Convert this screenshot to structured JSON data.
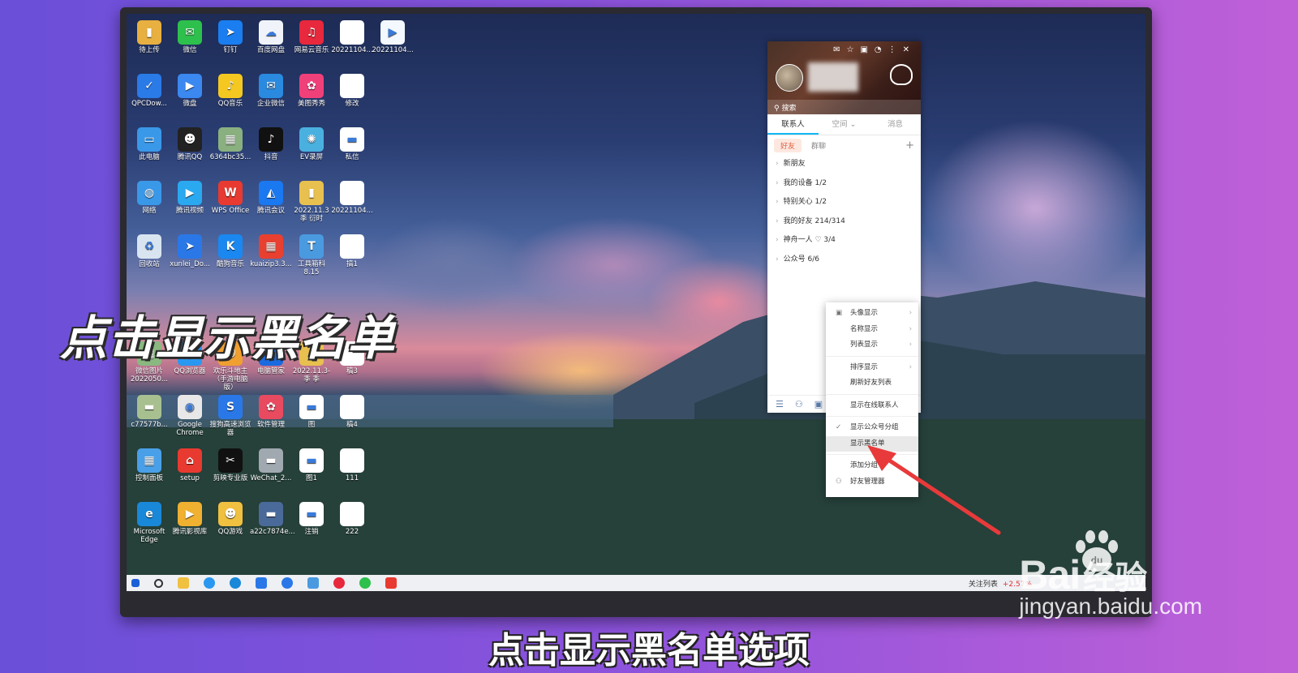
{
  "overlay": {
    "big_title": "点击显示黑名单",
    "caption": "点击显示黑名单选项"
  },
  "watermark": {
    "brand": "Bai",
    "brand_suffix": "经验",
    "url": "jingyan.baidu.com",
    "paw_label": "du"
  },
  "desktop_icons": [
    {
      "label": "待上传",
      "color": "#e8b040",
      "glyph": "▮"
    },
    {
      "label": "微信",
      "color": "#2ec04c",
      "glyph": "✉"
    },
    {
      "label": "钉钉",
      "color": "#1a7ef0",
      "glyph": "➤"
    },
    {
      "label": "百度网盘",
      "color": "#f0f4fa",
      "glyph": "☁"
    },
    {
      "label": "网易云音乐",
      "color": "#e8283c",
      "glyph": "♫"
    },
    {
      "label": "20221104...",
      "color": "#ffffff",
      "glyph": ""
    },
    {
      "label": "20221104...",
      "color": "#f4f8ff",
      "glyph": "▶"
    },
    {
      "label": "QPCDow...",
      "color": "#2a7ae8",
      "glyph": "✓"
    },
    {
      "label": "微盘",
      "color": "#3a88f0",
      "glyph": "▶"
    },
    {
      "label": "QQ音乐",
      "color": "#f4c820",
      "glyph": "♪"
    },
    {
      "label": "企业微信",
      "color": "#2a8ae0",
      "glyph": "✉"
    },
    {
      "label": "美图秀秀",
      "color": "#f0407a",
      "glyph": "✿"
    },
    {
      "label": "修改",
      "color": "#ffffff",
      "glyph": ""
    },
    {
      "label": "此电脑",
      "color": "#3a98e8",
      "glyph": "▭"
    },
    {
      "label": "腾讯QQ",
      "color": "#222222",
      "glyph": "☻"
    },
    {
      "label": "6364bc35...",
      "color": "#8ab080",
      "glyph": "▦"
    },
    {
      "label": "抖音",
      "color": "#111111",
      "glyph": "♪"
    },
    {
      "label": "EV录屏",
      "color": "#4ab0e0",
      "glyph": "✺"
    },
    {
      "label": "私信",
      "color": "#ffffff",
      "glyph": "▬"
    },
    {
      "label": "网络",
      "color": "#3a98e8",
      "glyph": "◍"
    },
    {
      "label": "腾讯视频",
      "color": "#2aa8f0",
      "glyph": "▶"
    },
    {
      "label": "WPS Office",
      "color": "#e83a30",
      "glyph": "W"
    },
    {
      "label": "腾讯会议",
      "color": "#1a78f0",
      "glyph": "◭"
    },
    {
      "label": "2022.11.3 季 衍时",
      "color": "#e8c050",
      "glyph": "▮"
    },
    {
      "label": "20221104...",
      "color": "#ffffff",
      "glyph": ""
    },
    {
      "label": "回收站",
      "color": "#d8e4f0",
      "glyph": "♻"
    },
    {
      "label": "xunlei_Do...",
      "color": "#2a78e8",
      "glyph": "➤"
    },
    {
      "label": "酷狗音乐",
      "color": "#1a88f0",
      "glyph": "K"
    },
    {
      "label": "kuaizip3.3...",
      "color": "#e84030",
      "glyph": "▦"
    },
    {
      "label": "工具箱科8.15",
      "color": "#4a9ae0",
      "glyph": "T"
    },
    {
      "label": "搞1",
      "color": "#ffffff",
      "glyph": ""
    },
    {
      "label": "微信图片 2022050...",
      "color": "#8ab880",
      "glyph": "▦"
    },
    {
      "label": "QQ浏览器",
      "color": "#2a98f0",
      "glyph": "◔"
    },
    {
      "label": "欢乐斗地主（手游电脑版）",
      "color": "#f0a030",
      "glyph": "☺"
    },
    {
      "label": "电脑管家",
      "color": "#1a6ae0",
      "glyph": "✓"
    },
    {
      "label": "2022.11.3-季 季",
      "color": "#e8c050",
      "glyph": "▮"
    },
    {
      "label": "稿3",
      "color": "#ffffff",
      "glyph": ""
    },
    {
      "label": "c77577b...",
      "color": "#a8c090",
      "glyph": "▬"
    },
    {
      "label": "Google Chrome",
      "color": "#e8e8e8",
      "glyph": "◉"
    },
    {
      "label": "搜狗高速浏览器",
      "color": "#2a78e8",
      "glyph": "S"
    },
    {
      "label": "软件管理",
      "color": "#e84a60",
      "glyph": "✿"
    },
    {
      "label": "图",
      "color": "#ffffff",
      "glyph": "▬"
    },
    {
      "label": "稿4",
      "color": "#ffffff",
      "glyph": ""
    },
    {
      "label": "控制面板",
      "color": "#4aa0e8",
      "glyph": "▦"
    },
    {
      "label": "setup",
      "color": "#e83a30",
      "glyph": "⌂"
    },
    {
      "label": "剪映专业版",
      "color": "#111111",
      "glyph": "✂"
    },
    {
      "label": "WeChat_2...",
      "color": "#a0a8b0",
      "glyph": "▬"
    },
    {
      "label": "图1",
      "color": "#ffffff",
      "glyph": "▬"
    },
    {
      "label": "111",
      "color": "#ffffff",
      "glyph": ""
    },
    {
      "label": "Microsoft Edge",
      "color": "#1a88d8",
      "glyph": "e"
    },
    {
      "label": "腾讯影视库",
      "color": "#f0b030",
      "glyph": "▶"
    },
    {
      "label": "QQ游戏",
      "color": "#f0c040",
      "glyph": "☻"
    },
    {
      "label": "a22c7874e...",
      "color": "#4a6a9a",
      "glyph": "▬"
    },
    {
      "label": "注销",
      "color": "#ffffff",
      "glyph": "▬"
    },
    {
      "label": "222",
      "color": "#ffffff",
      "glyph": ""
    }
  ],
  "qq": {
    "search_placeholder": "搜索",
    "tabs": [
      {
        "label": "联系人",
        "active": true
      },
      {
        "label": "空间 ⌄",
        "active": false
      },
      {
        "label": "消息",
        "active": false
      }
    ],
    "subtabs": {
      "friends": "好友",
      "groups": "群聊",
      "add": "+"
    },
    "groups": [
      {
        "label": "新朋友"
      },
      {
        "label": "我的设备 1/2"
      },
      {
        "label": "特别关心 1/2"
      },
      {
        "label": "我的好友 214/314"
      },
      {
        "label": "神舟一人 ♡ 3/4"
      },
      {
        "label": "公众号 6/6"
      }
    ]
  },
  "context_menu": {
    "items": [
      {
        "label": "头像显示",
        "arrow": "›",
        "prefix": "▣"
      },
      {
        "label": "名称显示",
        "arrow": "›",
        "prefix": ""
      },
      {
        "label": "列表显示",
        "arrow": "›",
        "prefix": ""
      },
      {
        "label": "排序显示",
        "arrow": "›",
        "prefix": ""
      },
      {
        "label": "刷新好友列表",
        "arrow": "",
        "prefix": ""
      },
      {
        "label": "显示在线联系人",
        "arrow": "",
        "prefix": ""
      },
      {
        "label": "显示公众号分组",
        "arrow": "",
        "prefix": "✓"
      },
      {
        "label": "显示黑名单",
        "arrow": "",
        "prefix": ""
      },
      {
        "label": "添加分组",
        "arrow": "",
        "prefix": ""
      },
      {
        "label": "好友管理器",
        "arrow": "",
        "prefix": "⚇"
      }
    ]
  },
  "taskbar": {
    "watch_list": "关注列表",
    "percent": "+2.57%"
  }
}
